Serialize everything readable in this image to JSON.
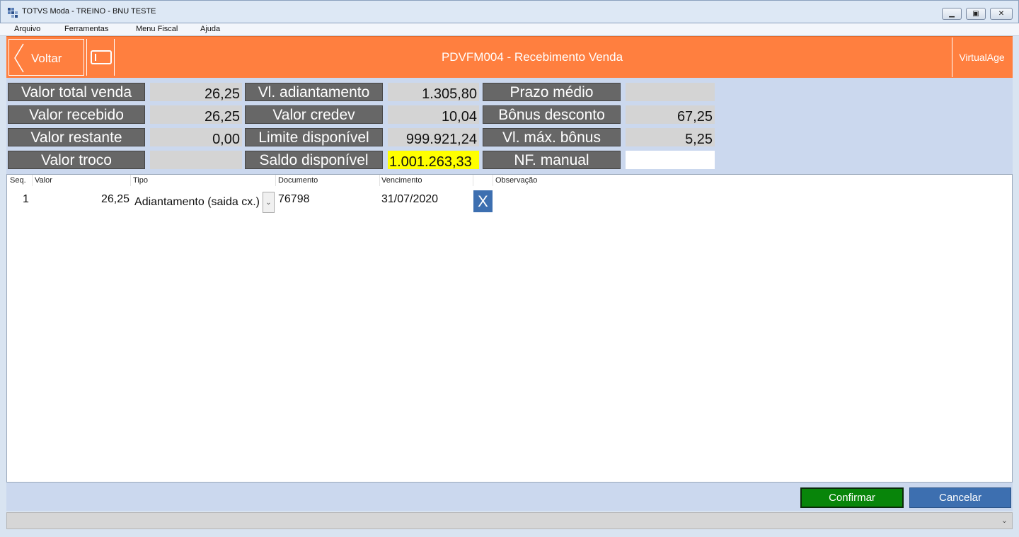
{
  "window": {
    "title": "TOTVS Moda - TREINO - BNU TESTE",
    "icon": "app-grid-icon",
    "minimize": "minimize-icon",
    "maximize": "maximize-icon",
    "close": "close-icon"
  },
  "menu": {
    "items": [
      {
        "label": "Arquivo"
      },
      {
        "label": "Ferramentas"
      },
      {
        "label": "Menu Fiscal"
      },
      {
        "label": "Ajuda"
      }
    ]
  },
  "header": {
    "back_label": "Voltar",
    "card_icon": "card-icon",
    "title": "PDVFM004 - Recebimento Venda",
    "brand": "VirtualAge",
    "color": "#ff7f3f"
  },
  "summary": {
    "valor_total_venda": {
      "label": "Valor total venda",
      "value": "26,25"
    },
    "valor_recebido": {
      "label": "Valor recebido",
      "value": "26,25"
    },
    "valor_restante": {
      "label": "Valor restante",
      "value": "0,00"
    },
    "valor_troco": {
      "label": "Valor troco",
      "value": ""
    },
    "vl_adiantamento": {
      "label": "Vl. adiantamento",
      "value": "1.305,80"
    },
    "valor_credev": {
      "label": "Valor credev",
      "value": "10,04"
    },
    "limite_disponivel": {
      "label": "Limite disponível",
      "value": "999.921,24"
    },
    "saldo_disponivel": {
      "label": "Saldo disponível",
      "value": "1.001.263,33"
    },
    "prazo_medio": {
      "label": "Prazo médio",
      "value": ""
    },
    "bonus_desconto": {
      "label": "Bônus desconto",
      "value": "67,25"
    },
    "vl_max_bonus": {
      "label": "Vl. máx. bônus",
      "value": "5,25"
    },
    "nf_manual": {
      "label": "NF. manual",
      "value": ""
    }
  },
  "grid": {
    "columns": [
      "Seq.",
      "Valor",
      "Tipo",
      "Documento",
      "Vencimento",
      "",
      "Observação"
    ],
    "rows": [
      {
        "seq": "1",
        "valor": "26,25",
        "tipo": "Adiantamento (saida cx.)",
        "documento": "76798",
        "vencimento": "31/07/2020",
        "delete": "X",
        "observacao": ""
      }
    ]
  },
  "footer": {
    "confirm": "Confirmar",
    "cancel": "Cancelar"
  },
  "status": {
    "text": "",
    "arrow": "chevron-down-icon"
  }
}
